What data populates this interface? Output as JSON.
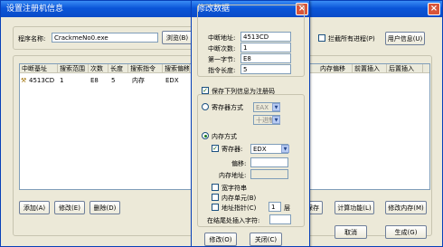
{
  "main": {
    "title": "设置注册机信息",
    "program_label": "程序名称:",
    "program_value": "CrackmeNo0.exe",
    "browse_label": "浏览(B)",
    "intercept_label": "拦截所有进程(P)",
    "user_info_label": "用户信息(U)",
    "columns": [
      "中断基址",
      "搜索范围",
      "次数",
      "长度",
      "搜索指令",
      "搜索偏移"
    ],
    "right_columns": [
      "内存偏移",
      "前置插入",
      "后置插入"
    ],
    "rows": [
      {
        "cells": [
          "4513CD",
          "1",
          "E8",
          "5",
          "内存",
          "EDX"
        ]
      }
    ],
    "add_label": "添加(A)",
    "modify_label": "修改(E)",
    "delete_label": "删除(D)",
    "save_label": "保存",
    "calc_label": "计算功能(L)",
    "modify_mem_label": "修改内存(M)",
    "cancel_label": "取消",
    "generate_label": "生成(G)"
  },
  "dialog": {
    "title": "修改数据",
    "addr_label": "中断地址:",
    "addr_value": "4513CD",
    "count_label": "中断次数:",
    "count_value": "1",
    "byte_label": "第一字节:",
    "byte_value": "E8",
    "len_label": "指令长度:",
    "len_value": "5",
    "save_check_label": "保存下列信息为注册码",
    "reg_mode_label": "寄存器方式",
    "reg_sel": "EAX",
    "fmt_sel": "十进制",
    "mem_mode_label": "内存方式",
    "mem_reg_label": "寄存器:",
    "mem_reg_value": "EDX",
    "offset_label": "偏移:",
    "mem_addr_label": "内存地址:",
    "wide_char_label": "宽字符串",
    "mem_unit_label": "内存单元(B)",
    "addr_ptr_label": "地址指针(C)",
    "layer_value": "1",
    "layer_label": "层",
    "tail_label": "在结尾处插入字符:",
    "ok_label": "修改(O)",
    "close_label": "关闭(C)"
  }
}
